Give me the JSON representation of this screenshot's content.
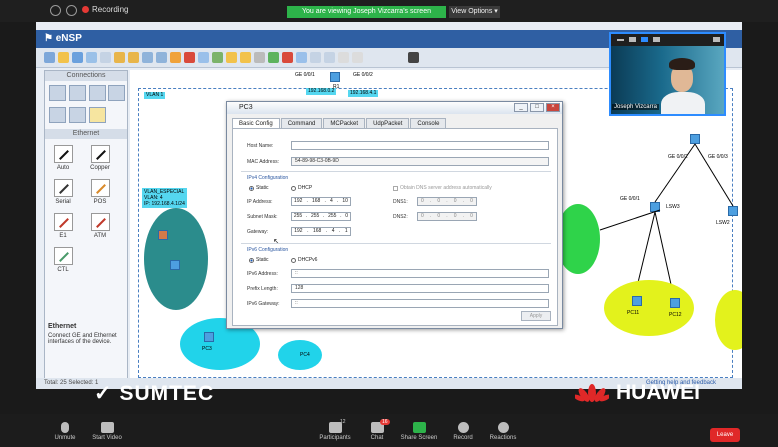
{
  "zoom": {
    "recording_label": "Recording",
    "viewing_banner": "You are viewing Joseph Vizcarra's screen",
    "view_options": "View Options",
    "participant_name": "Joseph Vizcarra",
    "participants_count": "12",
    "chat_badge": "16",
    "bottom": {
      "unmute": "Unmute",
      "start_video": "Start Video",
      "participants": "Participants",
      "chat": "Chat",
      "share_screen": "Share Screen",
      "record": "Record",
      "reactions": "Reactions",
      "leave": "Leave"
    },
    "colors": {
      "viewing_bg": "#2db34a",
      "leave_bg": "#e02828",
      "rec_dot": "#e53935"
    }
  },
  "ensp": {
    "title": "eNSP",
    "left_panel": {
      "connections_header": "Connections",
      "ethernet_header": "Ethernet",
      "cables": [
        "Auto",
        "Copper",
        "Serial",
        "POS",
        "E1",
        "ATM",
        "CTL"
      ],
      "desc_title": "Ethernet",
      "desc_text": "Connect GE and Ethernet interfaces of the device."
    },
    "canvas": {
      "vlan_note": [
        "VLAN_ESPECIAL",
        "VLAN: 4",
        "IP: 192.168.4.1/24"
      ],
      "tags": [
        "VLAN 1",
        "192.168.0.2",
        "192.168.4.1"
      ],
      "node_labels": [
        "GE 0/0/1",
        "GE 0/0/2",
        "R1",
        "GE 0/0/1",
        "GE 0/0/2",
        "GE 0/0/3",
        "PC3",
        "PC4",
        "LSW3",
        "PC11",
        "PC12",
        "LSW2"
      ]
    },
    "status_left": "Total: 25  Selected: 1",
    "status_right": "Getting help and feedback"
  },
  "dialog": {
    "title": "PC3",
    "tabs": [
      "Basic Config",
      "Command",
      "MCPacket",
      "UdpPacket",
      "Console"
    ],
    "host_name_label": "Host Name:",
    "host_name_value": "",
    "mac_label": "MAC Address:",
    "mac_value": "54-89-98-C3-0B-9D",
    "ipv4_section": "IPv4 Configuration",
    "static": "Static",
    "dhcp": "DHCP",
    "auto_dns": "Obtain DNS server address automatically",
    "ip_label": "IP Address:",
    "ip_value": [
      "192",
      "168",
      "4",
      "10"
    ],
    "mask_label": "Subnet Mask:",
    "mask_value": [
      "255",
      "255",
      "255",
      "0"
    ],
    "gw_label": "Gateway:",
    "gw_value": [
      "192",
      "168",
      "4",
      "1"
    ],
    "dns1_label": "DNS1:",
    "dns1_value": [
      "0",
      "0",
      "0",
      "0"
    ],
    "dns2_label": "DNS2:",
    "dns2_value": [
      "0",
      "0",
      "0",
      "0"
    ],
    "ipv6_section": "IPv6 Configuration",
    "dhcpv6": "DHCPv6",
    "ipv6_addr_label": "IPv6 Address:",
    "ipv6_addr_value": "::",
    "prefix_label": "Prefix Length:",
    "prefix_value": "128",
    "ipv6_gw_label": "IPv6 Gateway:",
    "ipv6_gw_value": "::",
    "apply": "Apply"
  },
  "logos": {
    "left": "SUMTEC",
    "right": "HUAWEI"
  }
}
